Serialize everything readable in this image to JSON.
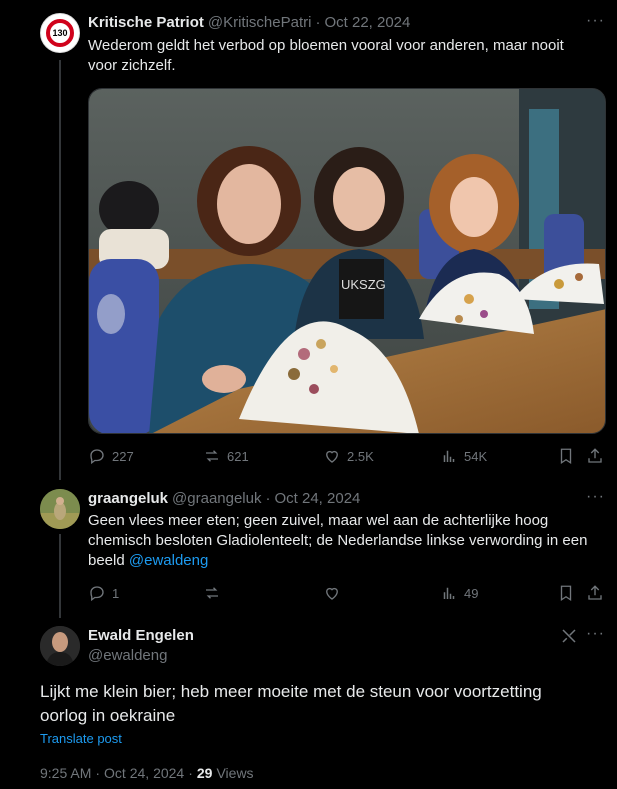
{
  "tweet1": {
    "name": "Kritische Patriot",
    "handle": "@KritischePatri",
    "sep": "·",
    "date": "Oct 22, 2024",
    "avatar_text": "130",
    "text_line1": "Wederom geldt het verbod op bloemen vooral voor anderen, maar nooit",
    "text_line2": "voor zichzelf.",
    "media_text": "UKSZG",
    "actions": {
      "replies": "227",
      "reposts": "621",
      "likes": "2.5K",
      "views": "54K"
    }
  },
  "tweet2": {
    "name": "graangeluk",
    "handle": "@graangeluk",
    "sep": "·",
    "date": "Oct 24, 2024",
    "text_line1": "Geen vlees meer eten; geen zuivel, maar wel aan de achterlijke hoog",
    "text_line2": "chemisch besloten Gladiolenteelt; de Nederlandse linkse verwording in een",
    "text_line3": "beeld ",
    "mention": "@ewaldeng",
    "actions": {
      "replies": "1",
      "reposts": "",
      "likes": "",
      "views": "49"
    }
  },
  "tweet3": {
    "name": "Ewald Engelen",
    "handle": "@ewaldeng",
    "text_line1": "Lijkt me klein bier; heb meer moeite met de steun voor voortzetting",
    "text_line2": "oorlog in oekraine",
    "translate": "Translate post",
    "time": "9:25 AM",
    "sep": "·",
    "date": "Oct 24, 2024",
    "sep2": "·",
    "views_count": "29",
    "views_label": "Views"
  },
  "more_label": "···",
  "colors": {
    "background": "#000000",
    "text": "#e7e9ea",
    "muted": "#71767b",
    "accent": "#1d9bf0",
    "divider": "#2f3336"
  }
}
